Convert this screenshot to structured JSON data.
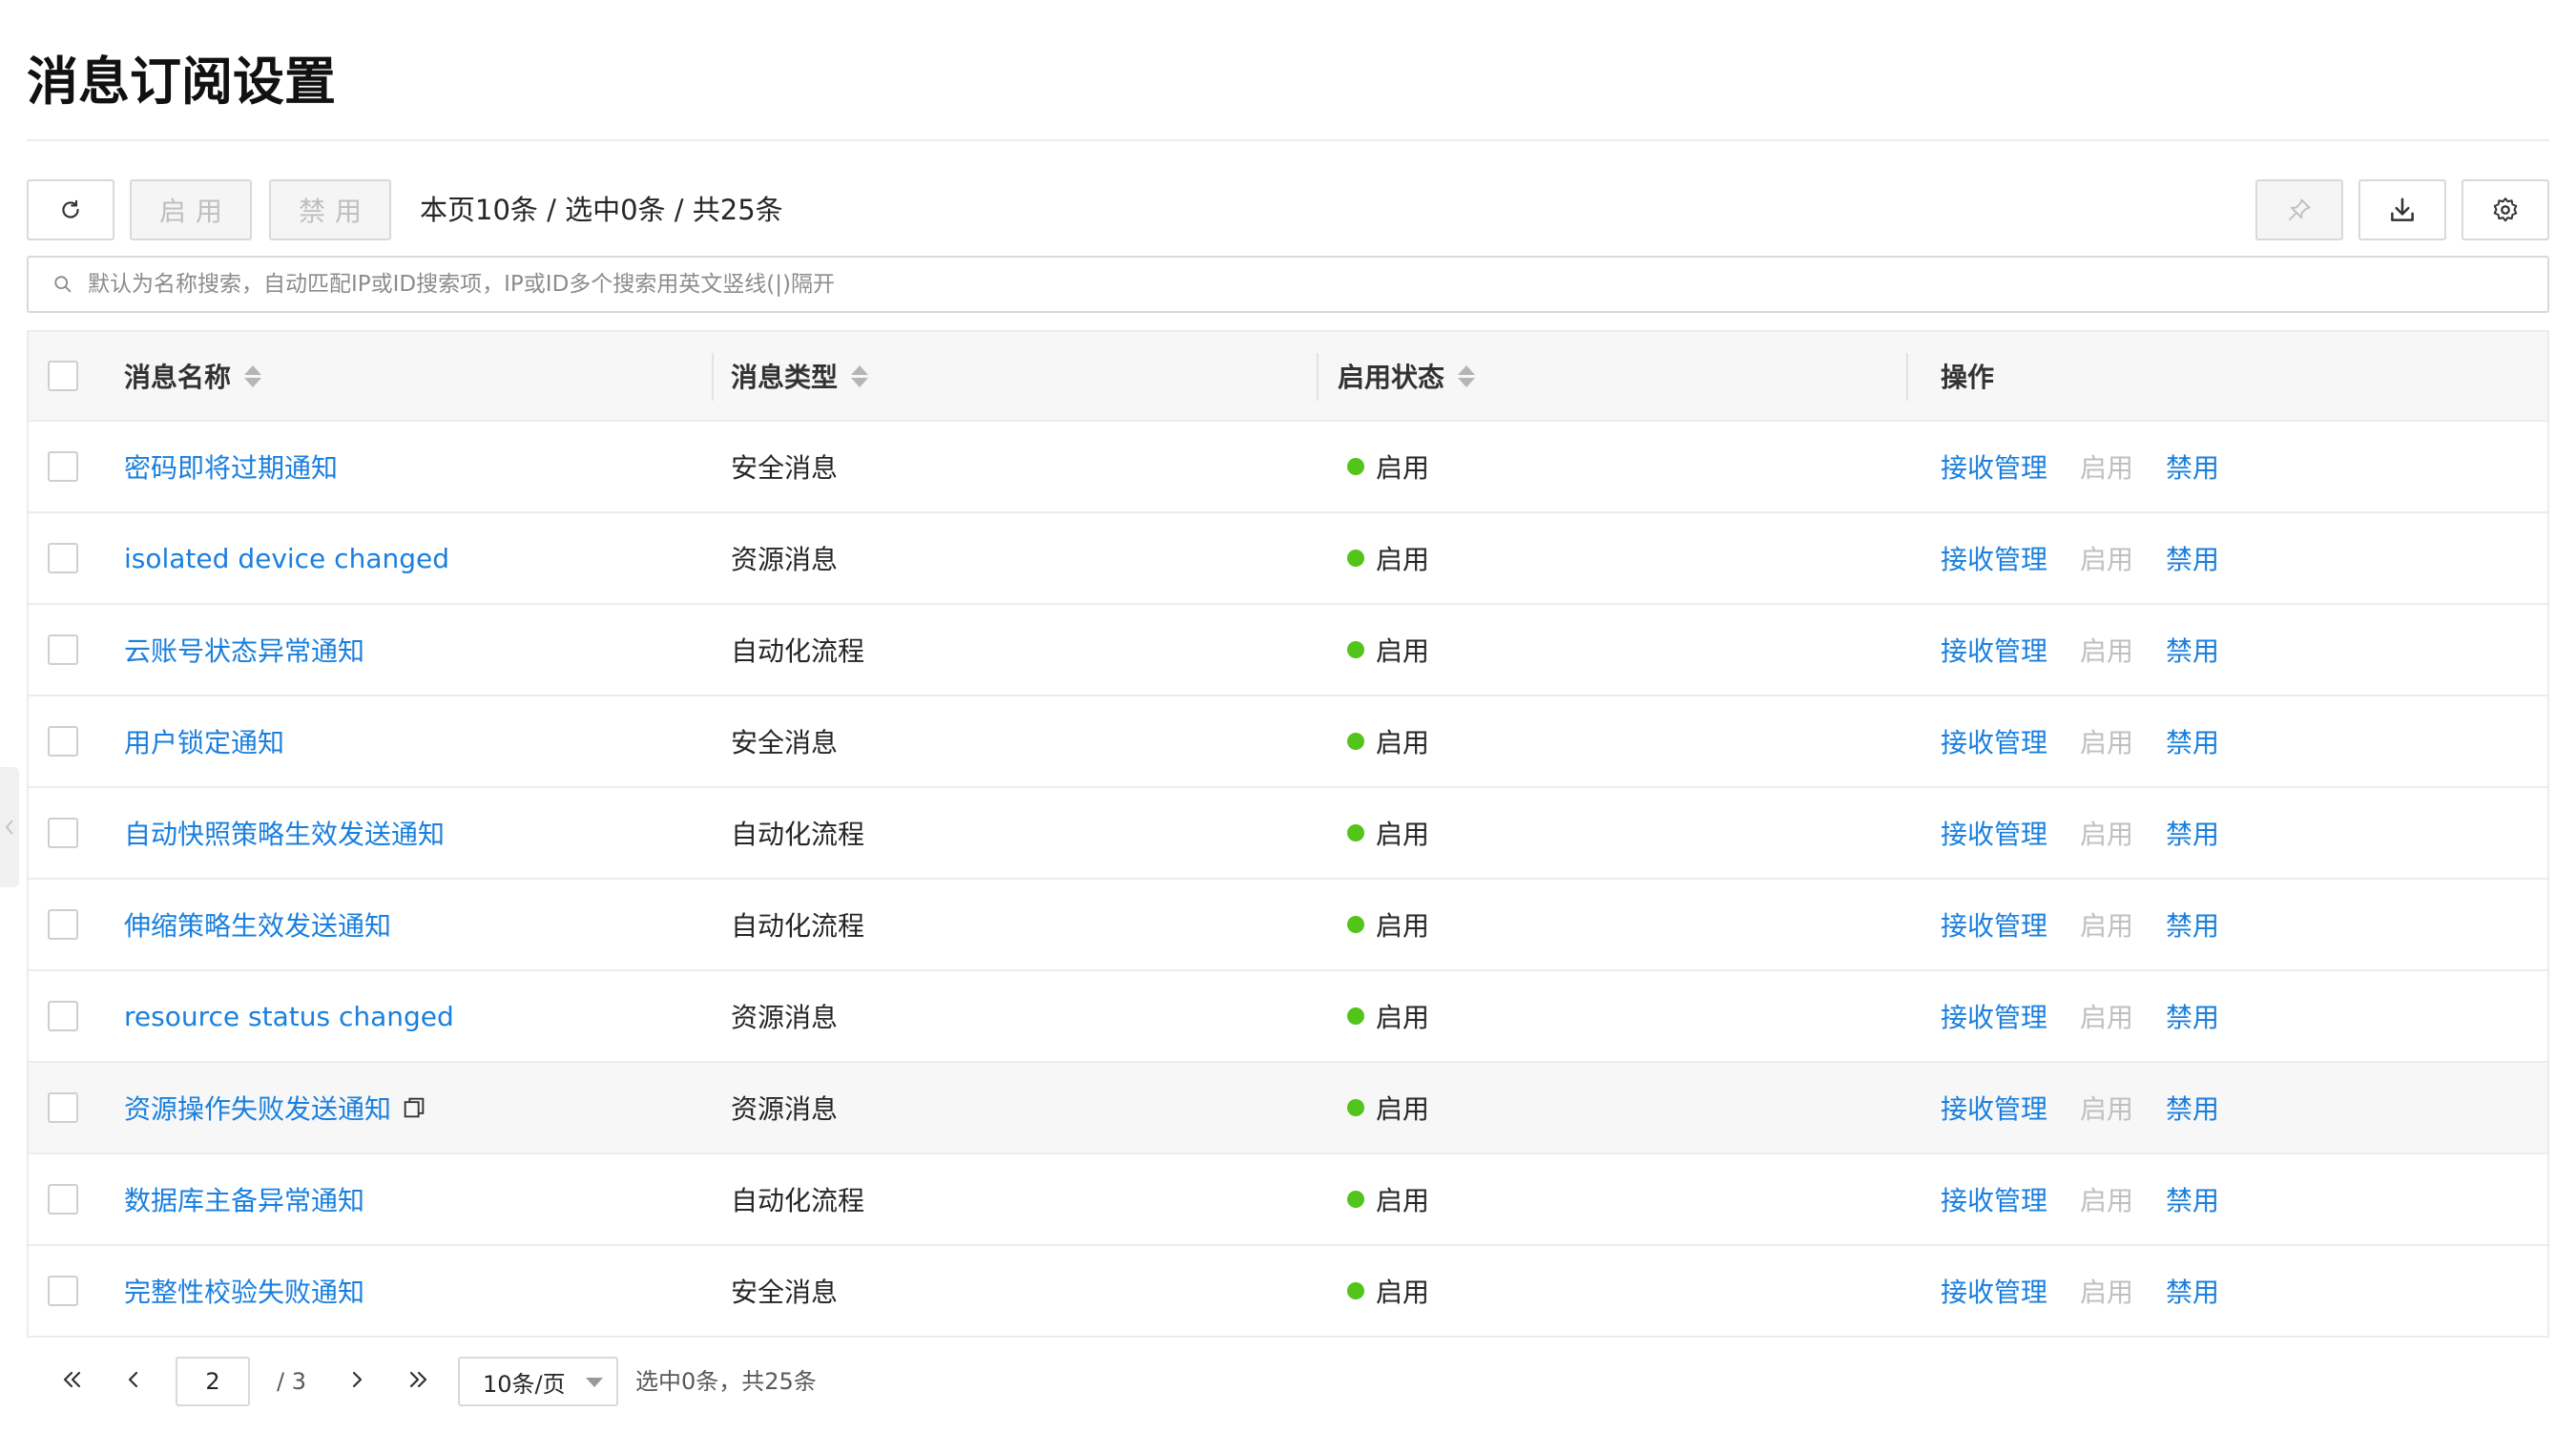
{
  "page": {
    "title": "消息订阅设置"
  },
  "toolbar": {
    "refresh_icon": "refresh-icon",
    "enable_label": "启用",
    "disable_label": "禁用",
    "count_text": "本页10条 / 选中0条 / 共25条",
    "pin_icon": "pin-icon",
    "download_icon": "download-icon",
    "settings_icon": "gear-icon"
  },
  "search": {
    "placeholder": "默认为名称搜索，自动匹配IP或ID搜索项，IP或ID多个搜索用英文竖线(|)隔开",
    "value": ""
  },
  "table": {
    "columns": {
      "name": "消息名称",
      "type": "消息类型",
      "status": "启用状态",
      "actions": "操作"
    },
    "action_labels": {
      "manage": "接收管理",
      "enable": "启用",
      "disable": "禁用"
    },
    "rows": [
      {
        "name": "密码即将过期通知",
        "type": "安全消息",
        "status": "启用"
      },
      {
        "name": "isolated device changed",
        "type": "资源消息",
        "status": "启用"
      },
      {
        "name": "云账号状态异常通知",
        "type": "自动化流程",
        "status": "启用"
      },
      {
        "name": "用户锁定通知",
        "type": "安全消息",
        "status": "启用"
      },
      {
        "name": "自动快照策略生效发送通知",
        "type": "自动化流程",
        "status": "启用"
      },
      {
        "name": "伸缩策略生效发送通知",
        "type": "自动化流程",
        "status": "启用"
      },
      {
        "name": "resource status changed",
        "type": "资源消息",
        "status": "启用"
      },
      {
        "name": "资源操作失败发送通知",
        "type": "资源消息",
        "status": "启用"
      },
      {
        "name": "数据库主备异常通知",
        "type": "自动化流程",
        "status": "启用"
      },
      {
        "name": "完整性校验失败通知",
        "type": "安全消息",
        "status": "启用"
      }
    ]
  },
  "pagination": {
    "current_page": "2",
    "total_pages": "/ 3",
    "page_size": "10条/页",
    "info": "选中0条，共25条"
  },
  "colors": {
    "link": "#1a7fde",
    "status_on": "#52c41a",
    "disabled_text": "#bfbfbf",
    "header_bg": "#f7f7f7"
  }
}
